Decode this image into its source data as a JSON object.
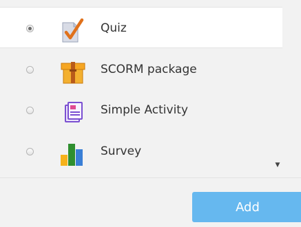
{
  "activities": [
    {
      "label": "Quiz",
      "icon": "quiz-icon",
      "selected": true
    },
    {
      "label": "SCORM package",
      "icon": "scorm-package-icon",
      "selected": false
    },
    {
      "label": "Simple Activity",
      "icon": "simple-activity-icon",
      "selected": false
    },
    {
      "label": "Survey",
      "icon": "survey-icon",
      "selected": false
    }
  ],
  "footer": {
    "add_label": "Add"
  },
  "colors": {
    "background": "#f2f2f2",
    "selected_row": "#ffffff",
    "add_button": "#66b8ef",
    "text": "#333333"
  }
}
